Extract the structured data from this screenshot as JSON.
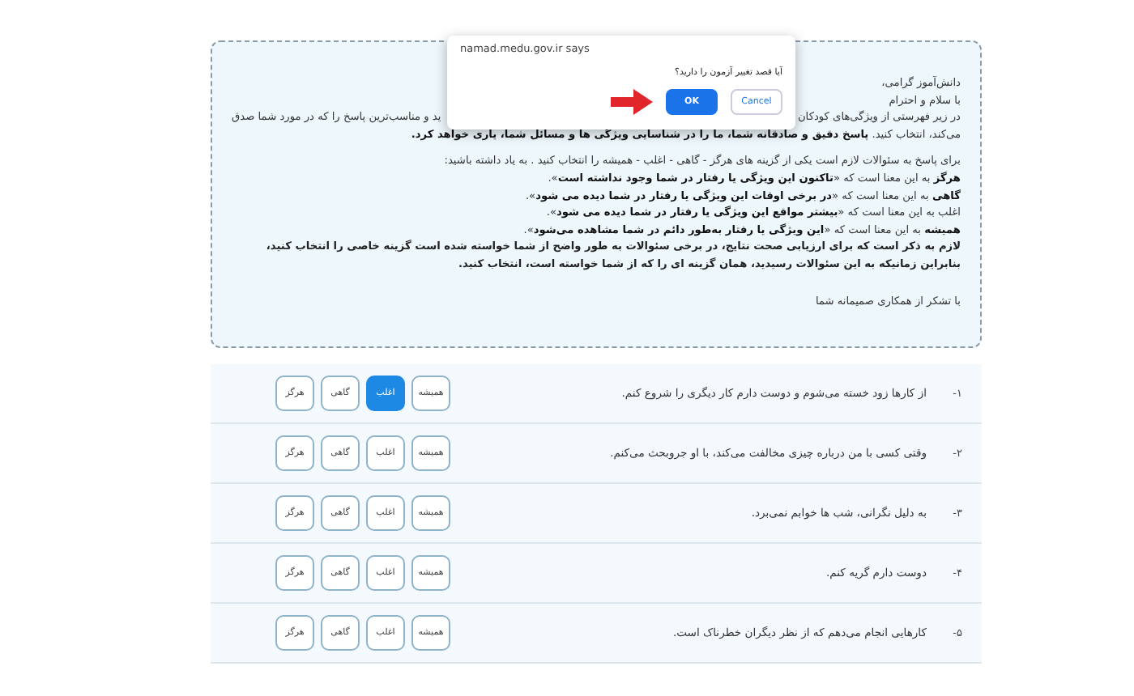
{
  "intro": {
    "greeting": "دانش‌آموز گرامی،",
    "salutation": "با سلام و احترام",
    "line_right": "در زیر فهرستی از ویژگی‌های کودکان",
    "line_left": "ید و مناسب‌ترین پاسخ را که در مورد شما صدق",
    "line_cont": "می‌کند، انتخاب کنید. **پاسخ دقیق و صادقانه شما، ما را در شناسایی ویژگی ها و مسائل شما، یاری خواهد کرد.**",
    "instructions": "برای پاسخ به سئوالات لازم است یکی از گزینه های هرگز - گاهی - اغلب - همیشه را انتخاب کنید . به یاد داشته باشید:",
    "definitions": [
      "**هرگز** به این معنا است که «**تاکنون این ویژگی یا رفتار در شما وجود نداشته است**».",
      "**گاهی** به این معنا است که «**در برخی اوقات این ویژگی یا رفتار در شما دیده می شود**».",
      "اغلب به این معنا است که «**بیشتر مواقع این ویژگی یا رفتار در شما دیده می شود**».",
      "**همیشه** به این معنا است که «**این ویژگی یا رفتار به‌طور دائم در شما مشاهده می‌شود**»."
    ],
    "note": "لازم به ذکر است که برای ارزیابی صحت نتایج، در برخی سئوالات به طور واضح از شما خواسته شده است گزینه خاصی را انتخاب کنید، بنابراین زمانیکه به این سئوالات رسیدید، همان گزینه ای را که از شما خواسته است، انتخاب کنید.",
    "thanks": "با تشکر از همکاری صمیمانه شما"
  },
  "dialog": {
    "origin": "namad.medu.gov.ir says",
    "message": "آیا قصد تغییر آزمون را دارید؟",
    "buttons": [
      {
        "label": "Cancel",
        "kind": "secondary"
      },
      {
        "label": "OK",
        "kind": "primary"
      }
    ]
  },
  "questions": [
    {
      "number": "۱-",
      "text": "از کارها زود خسته می‌شوم و دوست دارم کار دیگری را شروع کنم.",
      "options": [
        {
          "label": "همیشه",
          "selected": false
        },
        {
          "label": "اغلب",
          "selected": true
        },
        {
          "label": "گاهی",
          "selected": false
        },
        {
          "label": "هرگز",
          "selected": false
        }
      ]
    },
    {
      "number": "۲-",
      "text": "وقتی کسی با من درباره چیزی مخالفت می‌کند، با او جروبحث می‌کنم.",
      "options": [
        {
          "label": "همیشه",
          "selected": false
        },
        {
          "label": "اغلب",
          "selected": false
        },
        {
          "label": "گاهی",
          "selected": false
        },
        {
          "label": "هرگز",
          "selected": false
        }
      ]
    },
    {
      "number": "۳-",
      "text": "به دلیل نگرانی، شب ها خوابم نمی‌برد.",
      "options": [
        {
          "label": "همیشه",
          "selected": false
        },
        {
          "label": "اغلب",
          "selected": false
        },
        {
          "label": "گاهی",
          "selected": false
        },
        {
          "label": "هرگز",
          "selected": false
        }
      ]
    },
    {
      "number": "۴-",
      "text": "دوست دارم گریه کنم.",
      "options": [
        {
          "label": "همیشه",
          "selected": false
        },
        {
          "label": "اغلب",
          "selected": false
        },
        {
          "label": "گاهی",
          "selected": false
        },
        {
          "label": "هرگز",
          "selected": false
        }
      ]
    },
    {
      "number": "۵-",
      "text": "کارهایی انجام می‌دهم که از نظر دیگران خطرناک است.",
      "options": [
        {
          "label": "همیشه",
          "selected": false
        },
        {
          "label": "اغلب",
          "selected": false
        },
        {
          "label": "گاهی",
          "selected": false
        },
        {
          "label": "هرگز",
          "selected": false
        }
      ]
    }
  ]
}
